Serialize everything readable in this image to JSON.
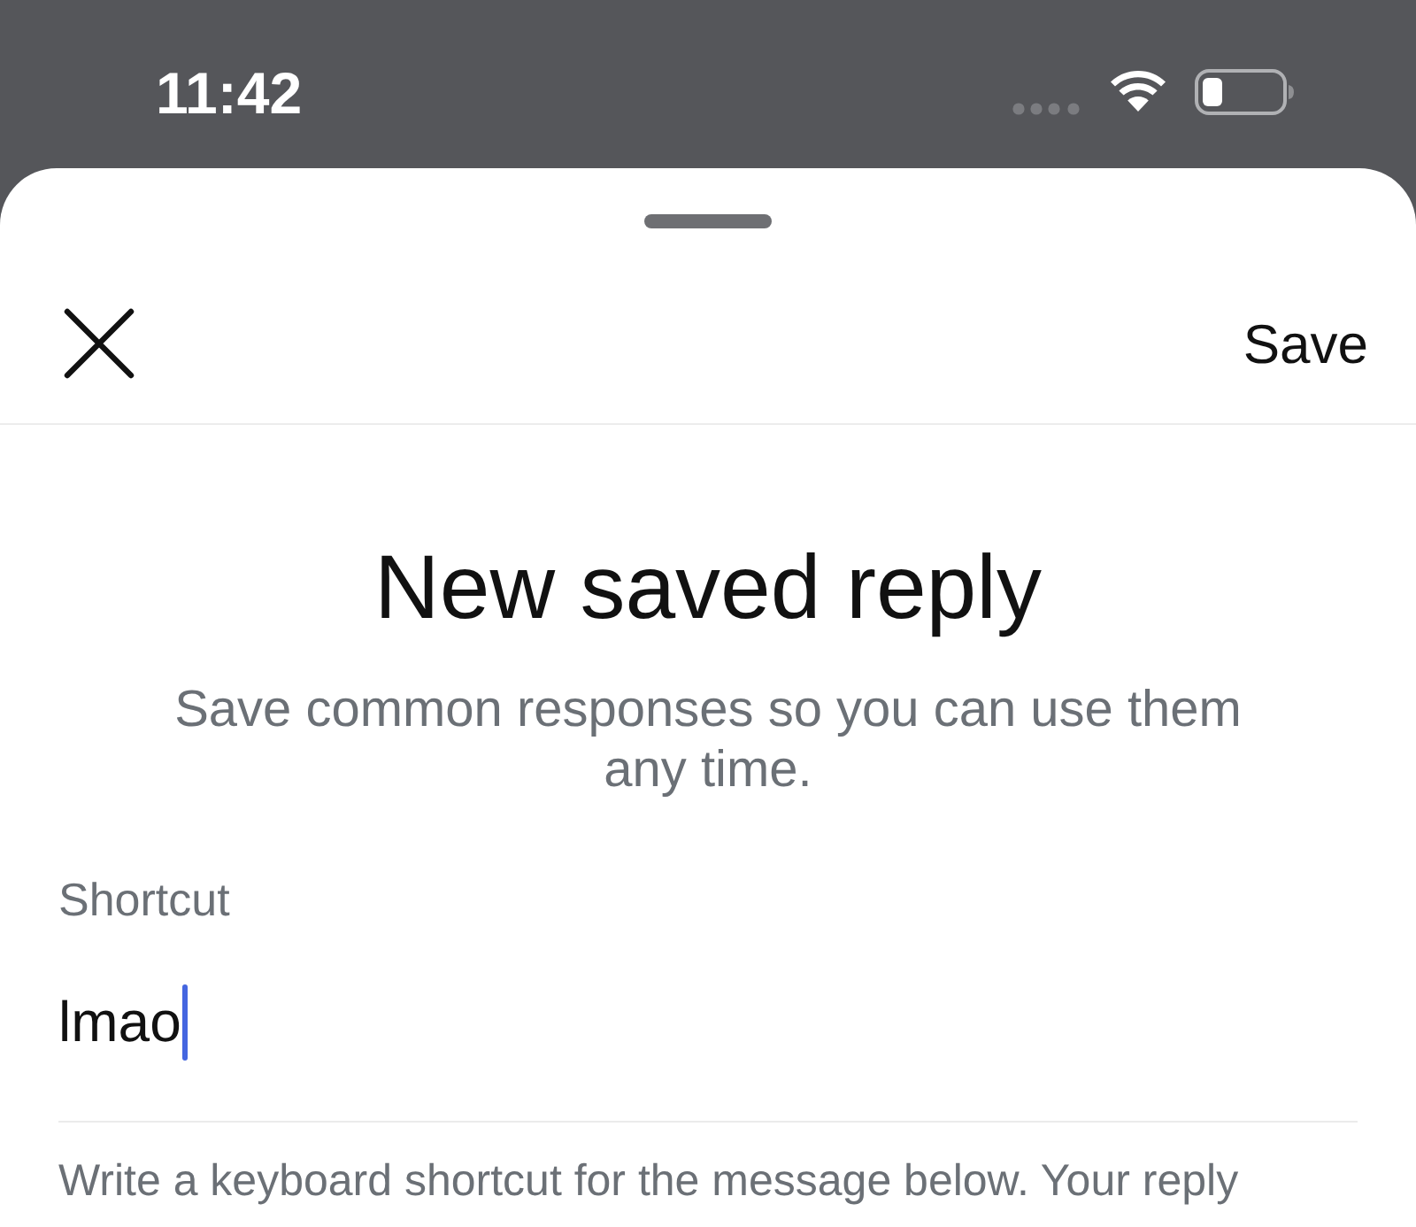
{
  "status_bar": {
    "time": "11:42"
  },
  "header": {
    "action_button": "Save"
  },
  "title": "New saved reply",
  "subtitle": "Save common responses so you can use them any time.",
  "shortcut_field": {
    "label": "Shortcut",
    "value": "lmao",
    "focused": true
  },
  "help_text": "Write a keyboard shortcut for the message below. Your reply"
}
